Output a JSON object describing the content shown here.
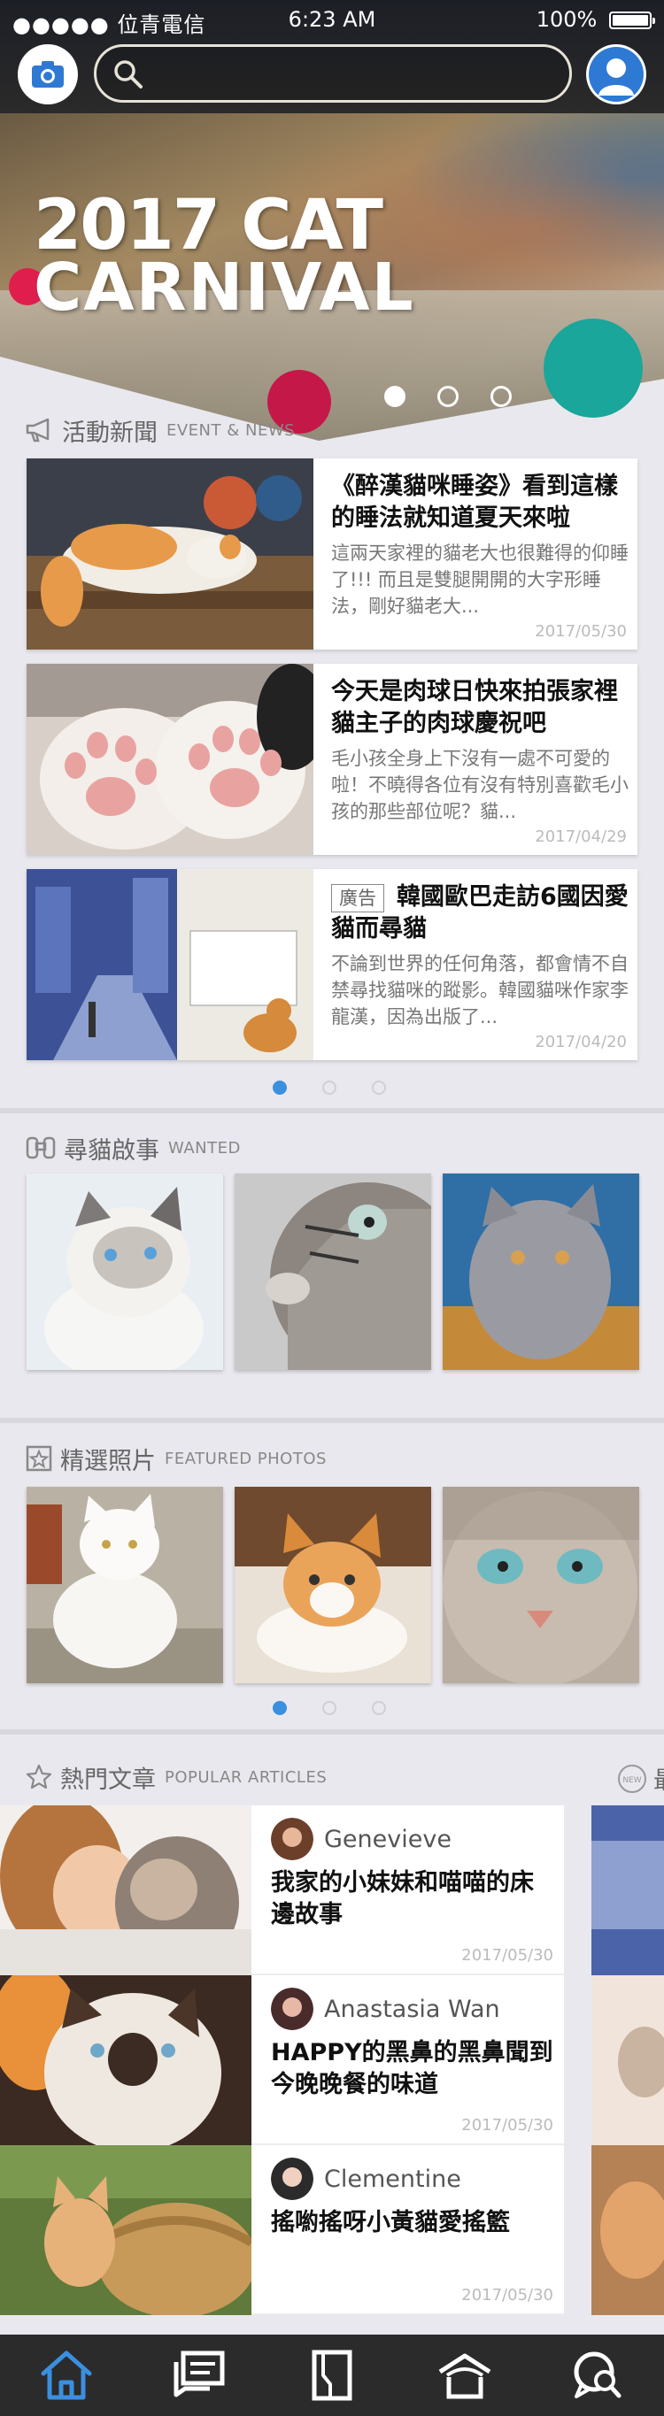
{
  "status_bar": {
    "carrier": "●●●●● 位青電信",
    "time": "6:23 AM",
    "battery": "100%"
  },
  "header": {
    "search_placeholder": ""
  },
  "hero": {
    "title_line1": "2017 CAT",
    "title_line2": "CARNIVAL",
    "slide_count": 3,
    "active_slide": 0
  },
  "news_section": {
    "title_zh": "活動新聞",
    "title_en": "EVENT & NEWS",
    "items": [
      {
        "title": "《醉漢貓咪睡姿》看到這樣的睡法就知道夏天來啦",
        "desc": "這兩天家裡的貓老大也很難得的仰睡了!!! 而且是雙腿開開的大字形睡法，剛好貓老大...",
        "date": "2017/05/30",
        "ad": ""
      },
      {
        "title": "今天是肉球日快來拍張家裡貓主子的肉球慶祝吧",
        "desc": "毛小孩全身上下沒有一處不可愛的啦！不曉得各位有沒有特別喜歡毛小孩的那些部位呢？貓...",
        "date": "2017/04/29",
        "ad": ""
      },
      {
        "title": "韓國歐巴走訪6國因愛貓而尋貓",
        "desc": "不論到世界的任何角落，都會情不自禁尋找貓咪的蹤影。韓國貓咪作家李龍漢，因為出版了...",
        "date": "2017/04/20",
        "ad": "廣告"
      }
    ]
  },
  "wanted_section": {
    "title_zh": "尋貓啟事",
    "title_en": "WANTED"
  },
  "photos_section": {
    "title_zh": "精選照片",
    "title_en": "FEATURED PHOTOS"
  },
  "popular_section": {
    "title_zh": "熱門文章",
    "title_en": "POPULAR ARTICLES",
    "next_badge": "NEW",
    "next_title_fragment": "最",
    "items": [
      {
        "author": "Genevieve",
        "title": "我家的小妹妹和喵喵的床邊故事",
        "date": "2017/05/30"
      },
      {
        "author": "Anastasia Wan",
        "title": "HAPPY的黑鼻的黑鼻聞到今晚晚餐的味道",
        "date": "2017/05/30"
      },
      {
        "author": "Clementine",
        "title": "搖喲搖呀小黃貓愛搖籃",
        "date": "2017/05/30"
      }
    ]
  },
  "colors": {
    "accent": "#3b8fdf",
    "header_bg": "#2b2a2a",
    "tabbar_bg": "#2b2b2b",
    "hero_red": "#e01e4e",
    "hero_teal": "#1aa69a"
  },
  "tabbar": {
    "items": [
      "home-icon",
      "chat-list-icon",
      "book-icon",
      "shelter-icon",
      "search-chat-icon"
    ],
    "active": 0
  }
}
